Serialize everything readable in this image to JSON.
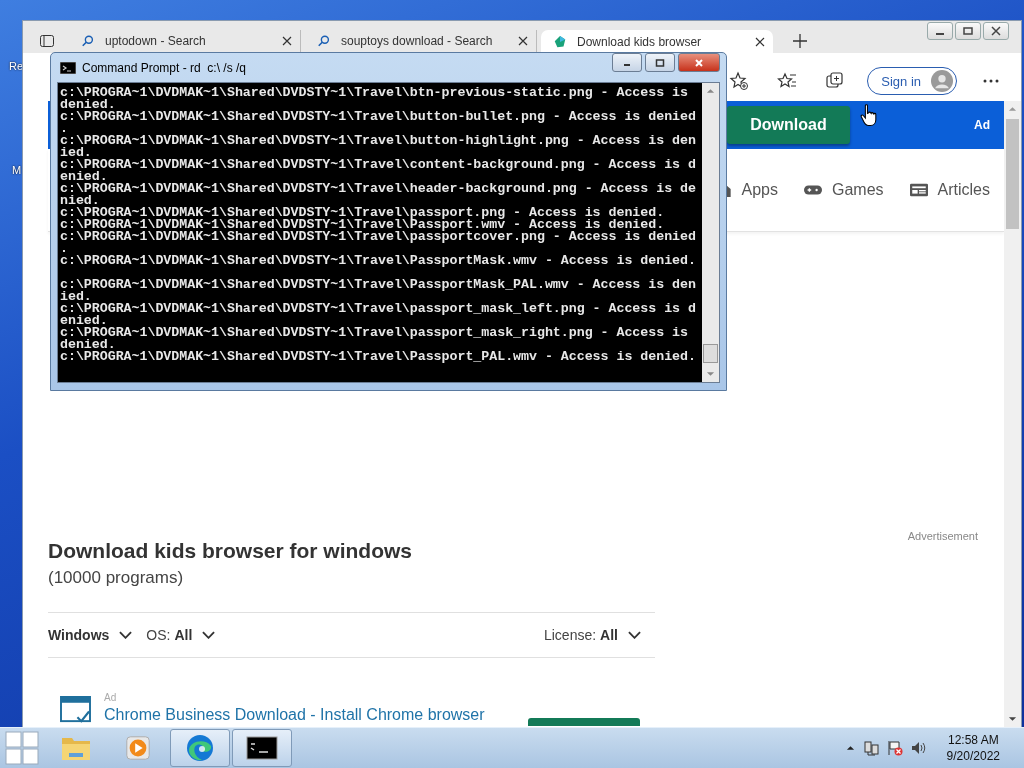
{
  "desktop": {
    "icon_labels": [
      "Re",
      "M"
    ]
  },
  "browser": {
    "tabs": [
      {
        "title": "uptodown - Search",
        "kind": "search",
        "selected": false
      },
      {
        "title": "souptoys download - Search",
        "kind": "search",
        "selected": false
      },
      {
        "title": "Download kids browser",
        "kind": "site",
        "selected": true
      }
    ],
    "sign_in": "Sign in",
    "page": {
      "download_button": "Download",
      "header_ad": "Ad",
      "nav": [
        {
          "label": "Apps",
          "kind": "apps"
        },
        {
          "label": "Games",
          "kind": "games"
        },
        {
          "label": "Articles",
          "kind": "articles"
        }
      ],
      "heading": "Download kids browser for windows",
      "count": "(10000 programs)",
      "advertisement": "Advertisement",
      "filters": {
        "platform": "Windows",
        "os_label": "OS:",
        "os_value": "All",
        "license_label": "License:",
        "license_value": "All"
      },
      "ad_result": {
        "ad_label": "Ad",
        "link": "Chrome Business Download - Install Chrome browser"
      }
    }
  },
  "console": {
    "title": "Command Prompt - rd  c:\\ /s /q",
    "rows": [
      {
        "text": "c:\\PROGRA~1\\DVDMAK~1\\Shared\\DVDSTY~1\\Travel\\btn-previous-static.png - Access is"
      },
      {
        "text": "denied."
      },
      {
        "text": "c:\\PROGRA~1\\DVDMAK~1\\Shared\\DVDSTY~1\\Travel\\button-bullet.png - Access is denied"
      },
      {
        "text": "."
      },
      {
        "text": "c:\\PROGRA~1\\DVDMAK~1\\Shared\\DVDSTY~1\\Travel\\button-highlight.png - Access is den"
      },
      {
        "text": "ied."
      },
      {
        "text": "c:\\PROGRA~1\\DVDMAK~1\\Shared\\DVDSTY~1\\Travel\\content-background.png - Access is d"
      },
      {
        "text": "enied."
      },
      {
        "text": "c:\\PROGRA~1\\DVDMAK~1\\Shared\\DVDSTY~1\\Travel\\header-background.png - Access is de"
      },
      {
        "text": "nied."
      },
      {
        "text": "c:\\PROGRA~1\\DVDMAK~1\\Shared\\DVDSTY~1\\Travel\\passport.png - Access is denied."
      },
      {
        "text": "c:\\PROGRA~1\\DVDMAK~1\\Shared\\DVDSTY~1\\Travel\\Passport.wmv - Access is denied."
      },
      {
        "text": "c:\\PROGRA~1\\DVDMAK~1\\Shared\\DVDSTY~1\\Travel\\passportcover.png - Access is denied"
      },
      {
        "text": "."
      },
      {
        "text": "c:\\PROGRA~1\\DVDMAK~1\\Shared\\DVDSTY~1\\Travel\\PassportMask.wmv - Access is denied.",
        "blank_after": true
      },
      {
        "text": "c:\\PROGRA~1\\DVDMAK~1\\Shared\\DVDSTY~1\\Travel\\PassportMask_PAL.wmv - Access is den"
      },
      {
        "text": "ied."
      },
      {
        "text": "c:\\PROGRA~1\\DVDMAK~1\\Shared\\DVDSTY~1\\Travel\\passport_mask_left.png - Access is d"
      },
      {
        "text": "enied."
      },
      {
        "text": "c:\\PROGRA~1\\DVDMAK~1\\Shared\\DVDSTY~1\\Travel\\passport_mask_right.png - Access is"
      },
      {
        "text": "denied."
      },
      {
        "text": "c:\\PROGRA~1\\DVDMAK~1\\Shared\\DVDSTY~1\\Travel\\Passport_PAL.wmv - Access is denied."
      }
    ]
  },
  "taskbar": {
    "apps": [
      {
        "kind": "explorer",
        "active": false
      },
      {
        "kind": "media",
        "active": false
      },
      {
        "kind": "edge",
        "active": true
      },
      {
        "kind": "console",
        "active": true
      }
    ],
    "time": "12:58 AM",
    "date": "9/20/2022"
  }
}
